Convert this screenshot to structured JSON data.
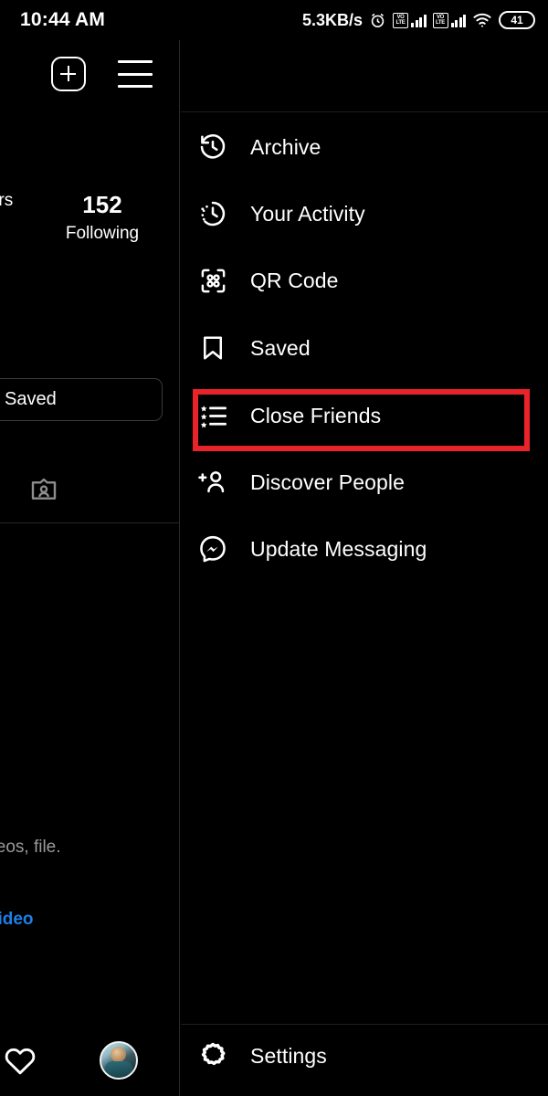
{
  "status_bar": {
    "time": "10:44 AM",
    "network_speed": "5.3KB/s",
    "alarm_icon": "alarm-clock-icon",
    "sim1_label_top": "VO",
    "sim1_label_bottom": "LTE",
    "sim2_label_top": "VO",
    "sim2_label_bottom": "LTE",
    "wifi_icon": "wifi-icon",
    "battery_level": "41"
  },
  "profile": {
    "add_post_icon": "add-post-icon",
    "menu_icon": "hamburger-menu-icon",
    "stats": [
      {
        "value": "",
        "label": "ers"
      },
      {
        "value": "152",
        "label": "Following"
      }
    ],
    "saved_button_label": "Saved",
    "tagged_tab_icon": "tagged-photos-icon",
    "empty_state_text": "videos, file.",
    "empty_state_link": "ideo",
    "bottom_nav": {
      "activity_icon": "heart-icon",
      "profile_avatar": "profile-avatar"
    }
  },
  "drawer": {
    "items": [
      {
        "label": "Archive",
        "icon": "archive-clock-icon"
      },
      {
        "label": "Your Activity",
        "icon": "activity-clock-icon"
      },
      {
        "label": "QR Code",
        "icon": "qr-code-icon"
      },
      {
        "label": "Saved",
        "icon": "bookmark-icon"
      },
      {
        "label": "Close Friends",
        "icon": "close-friends-star-list-icon"
      },
      {
        "label": "Discover People",
        "icon": "add-person-icon"
      },
      {
        "label": "Update Messaging",
        "icon": "messenger-icon"
      }
    ],
    "settings": {
      "label": "Settings",
      "icon": "settings-gear-icon"
    },
    "highlight": {
      "target": "Close Friends",
      "color": "#e8232a"
    }
  }
}
